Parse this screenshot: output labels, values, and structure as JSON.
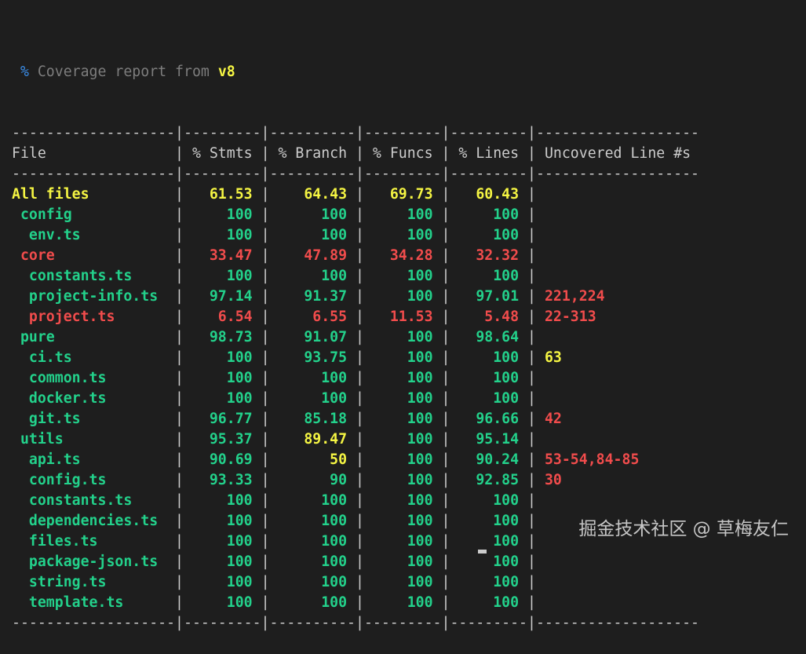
{
  "title": {
    "prefix": "%",
    "text": "Coverage report from",
    "engine": "v8"
  },
  "headers": [
    "File",
    "% Stmts",
    "% Branch",
    "% Funcs",
    "% Lines",
    "Uncovered Line #s"
  ],
  "colors": {
    "green": "#23d18b",
    "red": "#f14c4c",
    "yellow": "#f5f543",
    "text": "#cccccc",
    "background": "#1e1e1e"
  },
  "rows": [
    {
      "file": "All files",
      "indent": 0,
      "c": "y",
      "stmts": [
        "61.53",
        "y"
      ],
      "branch": [
        "64.43",
        "y"
      ],
      "funcs": [
        "69.73",
        "y"
      ],
      "lines": [
        "60.43",
        "y"
      ],
      "uncovered": [
        "",
        ""
      ]
    },
    {
      "file": "config",
      "indent": 1,
      "c": "g",
      "stmts": [
        "100",
        "g"
      ],
      "branch": [
        "100",
        "g"
      ],
      "funcs": [
        "100",
        "g"
      ],
      "lines": [
        "100",
        "g"
      ],
      "uncovered": [
        "",
        ""
      ]
    },
    {
      "file": "env.ts",
      "indent": 2,
      "c": "g",
      "stmts": [
        "100",
        "g"
      ],
      "branch": [
        "100",
        "g"
      ],
      "funcs": [
        "100",
        "g"
      ],
      "lines": [
        "100",
        "g"
      ],
      "uncovered": [
        "",
        ""
      ]
    },
    {
      "file": "core",
      "indent": 1,
      "c": "r",
      "stmts": [
        "33.47",
        "r"
      ],
      "branch": [
        "47.89",
        "r"
      ],
      "funcs": [
        "34.28",
        "r"
      ],
      "lines": [
        "32.32",
        "r"
      ],
      "uncovered": [
        "",
        ""
      ]
    },
    {
      "file": "constants.ts",
      "indent": 2,
      "c": "g",
      "stmts": [
        "100",
        "g"
      ],
      "branch": [
        "100",
        "g"
      ],
      "funcs": [
        "100",
        "g"
      ],
      "lines": [
        "100",
        "g"
      ],
      "uncovered": [
        "",
        ""
      ]
    },
    {
      "file": "project-info.ts",
      "indent": 2,
      "c": "g",
      "stmts": [
        "97.14",
        "g"
      ],
      "branch": [
        "91.37",
        "g"
      ],
      "funcs": [
        "100",
        "g"
      ],
      "lines": [
        "97.01",
        "g"
      ],
      "uncovered": [
        "221,224",
        "r"
      ]
    },
    {
      "file": "project.ts",
      "indent": 2,
      "c": "r",
      "stmts": [
        "6.54",
        "r"
      ],
      "branch": [
        "6.55",
        "r"
      ],
      "funcs": [
        "11.53",
        "r"
      ],
      "lines": [
        "5.48",
        "r"
      ],
      "uncovered": [
        "22-313",
        "r"
      ]
    },
    {
      "file": "pure",
      "indent": 1,
      "c": "g",
      "stmts": [
        "98.73",
        "g"
      ],
      "branch": [
        "91.07",
        "g"
      ],
      "funcs": [
        "100",
        "g"
      ],
      "lines": [
        "98.64",
        "g"
      ],
      "uncovered": [
        "",
        ""
      ]
    },
    {
      "file": "ci.ts",
      "indent": 2,
      "c": "g",
      "stmts": [
        "100",
        "g"
      ],
      "branch": [
        "93.75",
        "g"
      ],
      "funcs": [
        "100",
        "g"
      ],
      "lines": [
        "100",
        "g"
      ],
      "uncovered": [
        "63",
        "y"
      ]
    },
    {
      "file": "common.ts",
      "indent": 2,
      "c": "g",
      "stmts": [
        "100",
        "g"
      ],
      "branch": [
        "100",
        "g"
      ],
      "funcs": [
        "100",
        "g"
      ],
      "lines": [
        "100",
        "g"
      ],
      "uncovered": [
        "",
        ""
      ]
    },
    {
      "file": "docker.ts",
      "indent": 2,
      "c": "g",
      "stmts": [
        "100",
        "g"
      ],
      "branch": [
        "100",
        "g"
      ],
      "funcs": [
        "100",
        "g"
      ],
      "lines": [
        "100",
        "g"
      ],
      "uncovered": [
        "",
        ""
      ]
    },
    {
      "file": "git.ts",
      "indent": 2,
      "c": "g",
      "stmts": [
        "96.77",
        "g"
      ],
      "branch": [
        "85.18",
        "g"
      ],
      "funcs": [
        "100",
        "g"
      ],
      "lines": [
        "96.66",
        "g"
      ],
      "uncovered": [
        "42",
        "r"
      ]
    },
    {
      "file": "utils",
      "indent": 1,
      "c": "g",
      "stmts": [
        "95.37",
        "g"
      ],
      "branch": [
        "89.47",
        "y"
      ],
      "funcs": [
        "100",
        "g"
      ],
      "lines": [
        "95.14",
        "g"
      ],
      "uncovered": [
        "",
        ""
      ]
    },
    {
      "file": "api.ts",
      "indent": 2,
      "c": "g",
      "stmts": [
        "90.69",
        "g"
      ],
      "branch": [
        "50",
        "y"
      ],
      "funcs": [
        "100",
        "g"
      ],
      "lines": [
        "90.24",
        "g"
      ],
      "uncovered": [
        "53-54,84-85",
        "r"
      ]
    },
    {
      "file": "config.ts",
      "indent": 2,
      "c": "g",
      "stmts": [
        "93.33",
        "g"
      ],
      "branch": [
        "90",
        "g"
      ],
      "funcs": [
        "100",
        "g"
      ],
      "lines": [
        "92.85",
        "g"
      ],
      "uncovered": [
        "30",
        "r"
      ]
    },
    {
      "file": "constants.ts",
      "indent": 2,
      "c": "g",
      "stmts": [
        "100",
        "g"
      ],
      "branch": [
        "100",
        "g"
      ],
      "funcs": [
        "100",
        "g"
      ],
      "lines": [
        "100",
        "g"
      ],
      "uncovered": [
        "",
        ""
      ]
    },
    {
      "file": "dependencies.ts",
      "indent": 2,
      "c": "g",
      "stmts": [
        "100",
        "g"
      ],
      "branch": [
        "100",
        "g"
      ],
      "funcs": [
        "100",
        "g"
      ],
      "lines": [
        "100",
        "g"
      ],
      "uncovered": [
        "",
        ""
      ]
    },
    {
      "file": "files.ts",
      "indent": 2,
      "c": "g",
      "stmts": [
        "100",
        "g"
      ],
      "branch": [
        "100",
        "g"
      ],
      "funcs": [
        "100",
        "g"
      ],
      "lines": [
        "100",
        "g"
      ],
      "uncovered": [
        "",
        ""
      ]
    },
    {
      "file": "package-json.ts",
      "indent": 2,
      "c": "g",
      "stmts": [
        "100",
        "g"
      ],
      "branch": [
        "100",
        "g"
      ],
      "funcs": [
        "100",
        "g"
      ],
      "lines": [
        "100",
        "g"
      ],
      "uncovered": [
        "",
        ""
      ]
    },
    {
      "file": "string.ts",
      "indent": 2,
      "c": "g",
      "stmts": [
        "100",
        "g"
      ],
      "branch": [
        "100",
        "g"
      ],
      "funcs": [
        "100",
        "g"
      ],
      "lines": [
        "100",
        "g"
      ],
      "uncovered": [
        "",
        ""
      ]
    },
    {
      "file": "template.ts",
      "indent": 2,
      "c": "g",
      "stmts": [
        "100",
        "g"
      ],
      "branch": [
        "100",
        "g"
      ],
      "funcs": [
        "100",
        "g"
      ],
      "lines": [
        "100",
        "g"
      ],
      "uncovered": [
        "",
        ""
      ]
    }
  ],
  "watermark": "掘金技术社区 @ 草梅友仁"
}
